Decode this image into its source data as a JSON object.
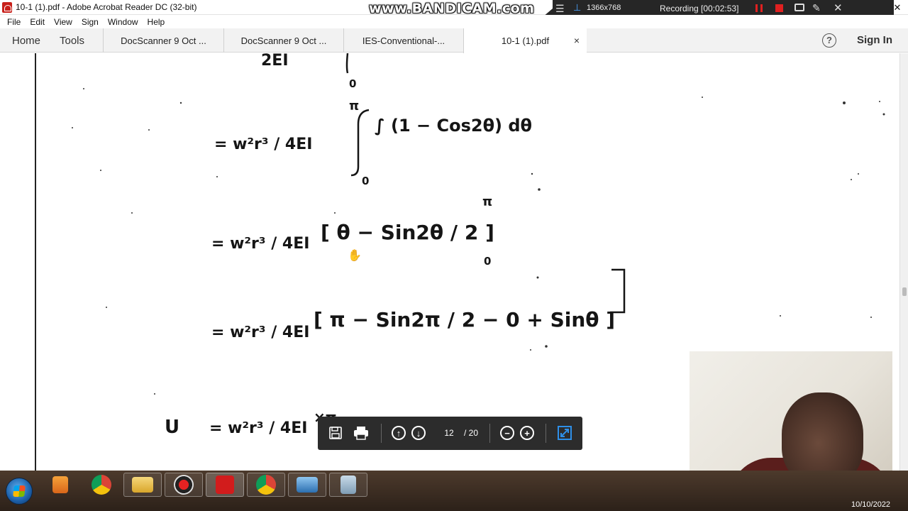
{
  "window": {
    "title": "10-1 (1).pdf - Adobe Acrobat Reader DC (32-bit)",
    "controls": {
      "minimize": "—",
      "restore": "❐",
      "close": "✕"
    }
  },
  "recorder": {
    "logo": "www.BANDICAM.com",
    "resolution": "1366x768",
    "status": "Recording [00:02:53]"
  },
  "menu": [
    "File",
    "Edit",
    "View",
    "Sign",
    "Window",
    "Help"
  ],
  "nav": {
    "home": "Home",
    "tools": "Tools",
    "tabs": [
      {
        "label": "DocScanner 9 Oct ...",
        "active": false
      },
      {
        "label": "DocScanner 9 Oct ...",
        "active": false
      },
      {
        "label": "IES-Conventional-...",
        "active": false
      },
      {
        "label": "10-1 (1).pdf",
        "active": true
      }
    ],
    "tab_close": "×",
    "help": "?",
    "sign_in": "Sign In"
  },
  "document": {
    "lines": [
      "2EI",
      "0",
      "π",
      "= w²r³ / 4EI",
      "∫ (1 − Cos2θ) dθ",
      "0",
      "= w²r³ / 4EI",
      "[ θ − Sin2θ / 2 ]",
      "π",
      "0",
      "= w²r³ / 4EI",
      "[ π − Sin2π / 2 − 0 + Sinθ ]",
      "U",
      "= w²r³ / 4EI",
      "×π"
    ]
  },
  "viewer_toolbar": {
    "current_page": "12",
    "total_pages": "/ 20"
  },
  "taskbar": {
    "date": "10/10/2022"
  }
}
